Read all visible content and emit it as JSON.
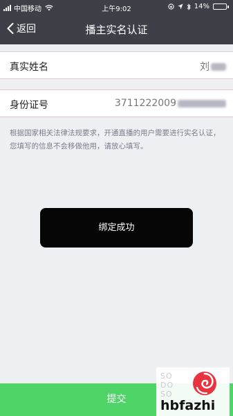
{
  "status_bar": {
    "carrier": "中国移动",
    "time": "上午9:02",
    "battery_percent": "14%",
    "battery_level": 0.14,
    "icons": [
      "signal-icon",
      "wifi-icon",
      "lock-rotation-icon",
      "location-icon",
      "bluetooth-icon",
      "battery-icon"
    ]
  },
  "nav": {
    "back_label": "返回",
    "title": "播主实名认证"
  },
  "form": {
    "name_label": "真实姓名",
    "name_value": "刘",
    "id_label": "身份证号",
    "id_value": "3711222009"
  },
  "notice": "根据国家相关法律法规要求，开通直播的用户需要进行实名认证，您填写的信息不会移做他用，请放心填写。",
  "toast": "绑定成功",
  "submit_label": "提交",
  "watermark": {
    "brand": "hbfazhi",
    "ghost_lines": [
      "SO",
      "DO",
      "SO",
      "DO"
    ]
  },
  "colors": {
    "header_bg": "#3d4147",
    "submit_green": "#4fd468",
    "toast_bg": "#060606",
    "page_bg": "#eef0f4"
  }
}
